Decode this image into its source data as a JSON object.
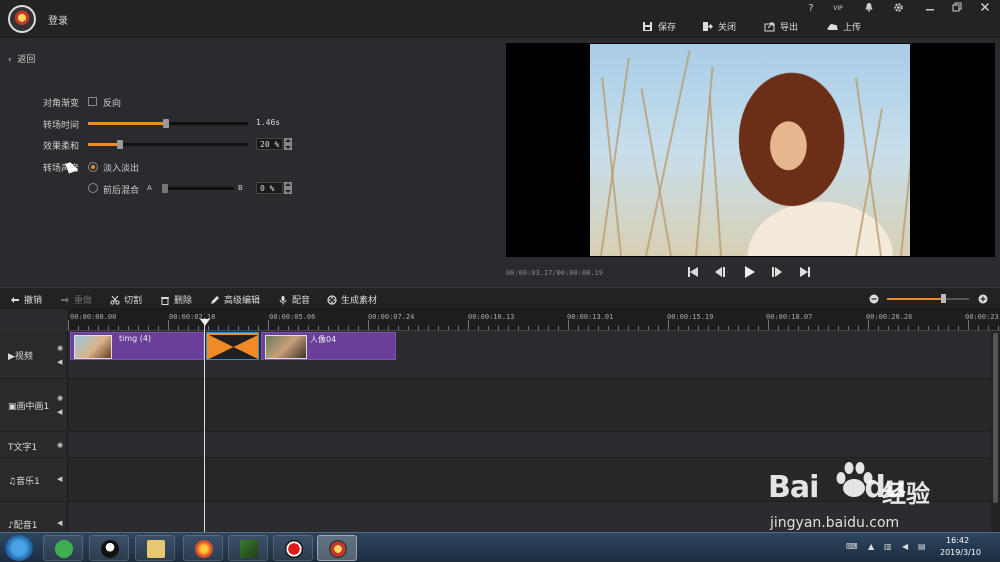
{
  "app": {
    "login_label": "登录",
    "actions": {
      "save": "保存",
      "close": "关闭",
      "export": "导出",
      "upload": "上传"
    },
    "window_icons": [
      "help-icon",
      "vip-icon",
      "bell-icon",
      "gear-icon",
      "minimize-icon",
      "restore-icon",
      "close-icon"
    ],
    "help_glyph": "?",
    "vip_label": "VIP"
  },
  "settings": {
    "back_label": "返回",
    "diagonal_fade_label": "对角渐变",
    "reverse_label": "反向",
    "reverse_checked": false,
    "duration_label": "转场时间",
    "duration_value": "1.46s",
    "duration_fraction": 0.49,
    "softness_label": "效果柔和",
    "softness_value": "20 %",
    "softness_fraction": 0.2,
    "sound_label": "转场声音",
    "sound_options": [
      {
        "label": "淡入淡出",
        "selected": true
      },
      {
        "label": "前后混合",
        "selected": false
      }
    ],
    "mix_a_label": "A",
    "mix_b_label": "B",
    "mix_value": "0 %",
    "mix_fraction": 0.0
  },
  "preview": {
    "timecode": "00:00:03.17/00:00:08.19",
    "controls": [
      "skip-start-icon",
      "step-back-icon",
      "play-icon",
      "step-forward-icon",
      "skip-end-icon"
    ]
  },
  "toolbar": {
    "undo": "撤销",
    "redo": "重做",
    "cut": "切割",
    "delete": "删除",
    "advanced_edit": "高级编辑",
    "dub": "配音",
    "generate_material": "生成素材",
    "zoom_fraction": 0.7
  },
  "timeline": {
    "ruler_labels": [
      "00:00:00.00",
      "00:00:02.18",
      "00:00:05.06",
      "00:00:07.24",
      "00:00:10.13",
      "00:00:13.01",
      "00:00:15.19",
      "00:00:18.07",
      "00:00:20.26",
      "00:00:23."
    ],
    "tracks": [
      "视频",
      "画中画1",
      "文字1",
      "音乐1",
      "配音1"
    ],
    "clips": [
      {
        "name": "timg (4)"
      },
      {
        "name": "人像04"
      }
    ]
  },
  "taskbar": {
    "time": "16:42",
    "date": "2019/3/10",
    "apps": [
      "start-orb",
      "360-browser-icon",
      "qq-icon",
      "file-explorer-icon",
      "firefox-icon",
      "media-player-icon",
      "record-icon",
      "video-editor-icon"
    ]
  },
  "watermark": {
    "brand": "Bai",
    "brand2": "du",
    "cn": "经验",
    "url": "jingyan.baidu.com"
  },
  "colors": {
    "accent": "#f08a24",
    "clip": "#6a3f9a",
    "background": "#2b2b2f"
  }
}
